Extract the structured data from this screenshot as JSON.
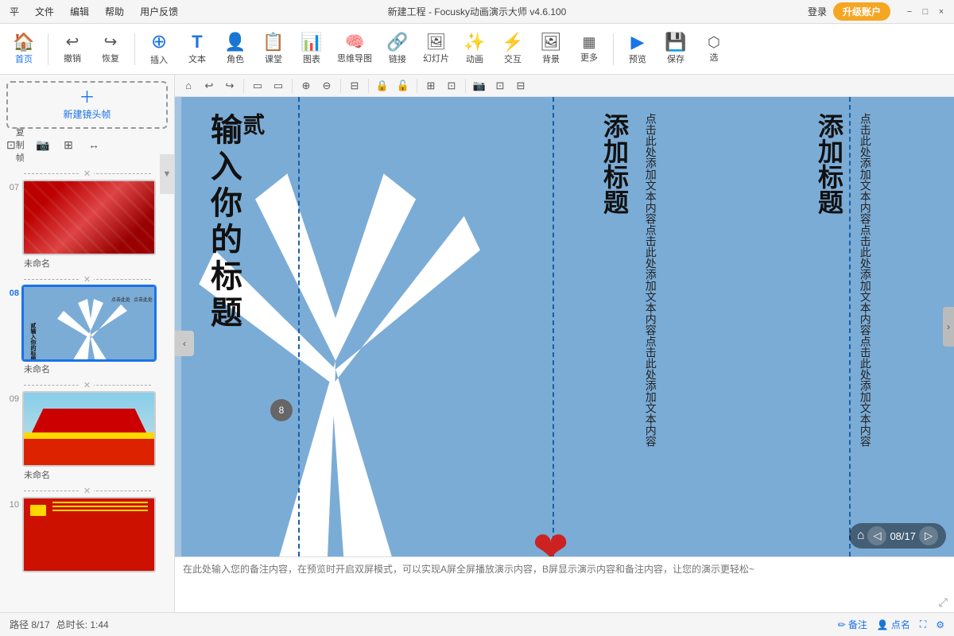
{
  "titlebar": {
    "menu_items": [
      "平",
      "文件",
      "编辑",
      "帮助",
      "用户反馈"
    ],
    "title": "新建工程 - Focusky动画演示大师 v4.6.100",
    "login": "登录",
    "upgrade": "升级账户",
    "win_btns": [
      "−",
      "□",
      "×"
    ]
  },
  "toolbar": {
    "items": [
      {
        "id": "home",
        "icon": "🏠",
        "label": "首页"
      },
      {
        "id": "undo",
        "icon": "↩",
        "label": "撤销"
      },
      {
        "id": "redo",
        "icon": "↪",
        "label": "恢复"
      },
      {
        "id": "insert",
        "icon": "⊕",
        "label": "插入"
      },
      {
        "id": "text",
        "icon": "T",
        "label": "文本"
      },
      {
        "id": "role",
        "icon": "👤",
        "label": "角色"
      },
      {
        "id": "class",
        "icon": "📋",
        "label": "课堂"
      },
      {
        "id": "chart",
        "icon": "📊",
        "label": "图表"
      },
      {
        "id": "mindmap",
        "icon": "🧠",
        "label": "思维导图"
      },
      {
        "id": "link",
        "icon": "🔗",
        "label": "链接"
      },
      {
        "id": "slide",
        "icon": "🖼",
        "label": "幻灯片"
      },
      {
        "id": "anim",
        "icon": "✨",
        "label": "动画"
      },
      {
        "id": "interact",
        "icon": "⚡",
        "label": "交互"
      },
      {
        "id": "bg",
        "icon": "🖼",
        "label": "背景"
      },
      {
        "id": "more",
        "icon": "⋯",
        "label": "更多"
      },
      {
        "id": "preview",
        "icon": "▶",
        "label": "预览"
      },
      {
        "id": "save",
        "icon": "💾",
        "label": "保存"
      },
      {
        "id": "select",
        "icon": "⬡",
        "label": "选"
      }
    ]
  },
  "canvas_toolbar": {
    "buttons": [
      "⌂",
      "↩",
      "↪",
      "▭",
      "▭",
      "⊕",
      "⊖",
      "⊟",
      "⊞",
      "⊡",
      "🔒",
      "🔓",
      "⊞",
      "⊡",
      "⊡",
      "⊟"
    ]
  },
  "slide_list": {
    "new_frame_label": "新建镜头帧",
    "action_labels": [
      "复制帧",
      "📷",
      "⊞",
      "↔"
    ],
    "items": [
      {
        "num": "07",
        "label": "未命名",
        "type": "red"
      },
      {
        "num": "08",
        "label": "未命名",
        "type": "blue",
        "active": true
      },
      {
        "num": "09",
        "label": "未命名",
        "type": "temple"
      },
      {
        "num": "10",
        "label": "",
        "type": "redflag"
      }
    ]
  },
  "canvas": {
    "main_text": "贰输入你的标题",
    "badge_num": "8",
    "col1": {
      "title": "添加标题",
      "body": "点击此处添加文本内容点击此处添加文本内容点击此处添加文本内容"
    },
    "col2": {
      "title": "添加标题",
      "body": "点击此处添加文本内容点击此处添加文本内容点击此处添加文本内容"
    },
    "page_nav": "08/17"
  },
  "notes": {
    "placeholder": "在此处输入您的备注内容，在预览时开启双屏模式，可以实现A屏全屏播放演示内容，B屏显示演示内容和备注内容，让您的演示更轻松~"
  },
  "statusbar": {
    "path": "路径 8/17",
    "duration": "总时长: 1:44",
    "note_btn": "备注",
    "attend_btn": "点名"
  }
}
